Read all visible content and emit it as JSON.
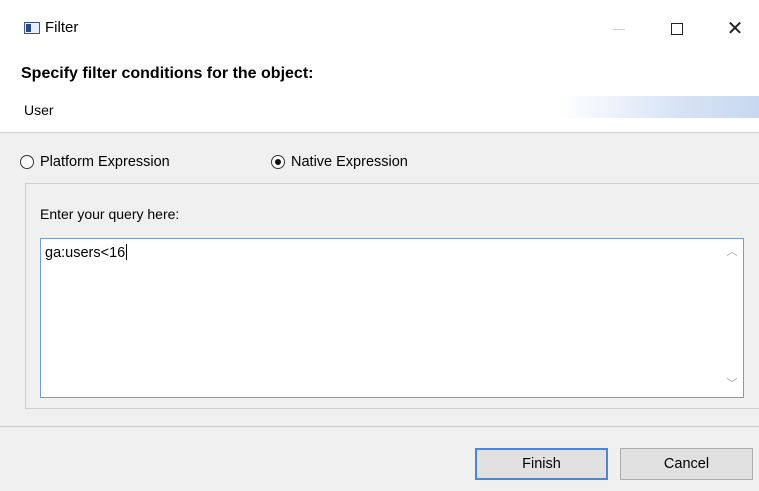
{
  "window": {
    "title": "Filter",
    "icon": "app-window-icon"
  },
  "header": {
    "heading": "Specify filter conditions for the object:",
    "object_name": "User"
  },
  "options": {
    "platform_label": "Platform Expression",
    "native_label": "Native Expression",
    "selected": "Native Expression"
  },
  "query": {
    "label": "Enter your query here:",
    "value": "ga:users<16"
  },
  "buttons": {
    "finish": "Finish",
    "cancel": "Cancel"
  },
  "colors": {
    "body_background": "#f0f0f0",
    "focus_border": "#4a87d8"
  }
}
